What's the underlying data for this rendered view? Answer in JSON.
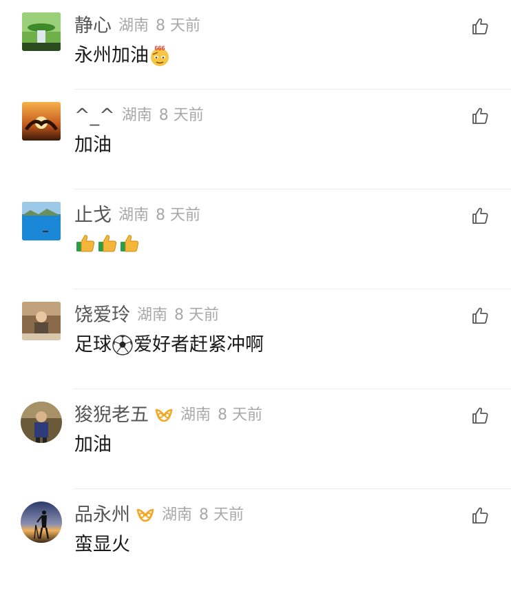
{
  "comments": [
    {
      "username": "静心",
      "location": "湖南",
      "time": "8 天前",
      "content_parts": [
        "永州加油"
      ],
      "emoji_badge": "666"
    },
    {
      "username": "^_^",
      "location": "湖南",
      "time": "8 天前",
      "content_parts": [
        "加油"
      ]
    },
    {
      "username": "止戈",
      "location": "湖南",
      "time": "8 天前",
      "content_parts": []
    },
    {
      "username": "饶爱玲",
      "location": "湖南",
      "time": "8 天前",
      "content_parts": [
        "足球",
        "爱好者赶紧冲啊"
      ]
    },
    {
      "username": "狻猊老五",
      "location": "湖南",
      "time": "8 天前",
      "content_parts": [
        "加油"
      ]
    },
    {
      "username": "品永州",
      "location": "湖南",
      "time": "8 天前",
      "content_parts": [
        "蛮显火"
      ]
    }
  ],
  "icons": {
    "like": "thumbs-up-outline-icon",
    "vip": "vip-badge-icon",
    "emoji_666": "666-emoji-icon",
    "emoji_thumbs_up": "thumbs-up-emoji-icon",
    "emoji_soccer": "soccer-ball-emoji-icon"
  },
  "colors": {
    "username": "#555555",
    "meta": "#a8a8a8",
    "content": "#1a1a1a",
    "divider": "#ebebeb",
    "vip_badge": "#f5a623"
  }
}
